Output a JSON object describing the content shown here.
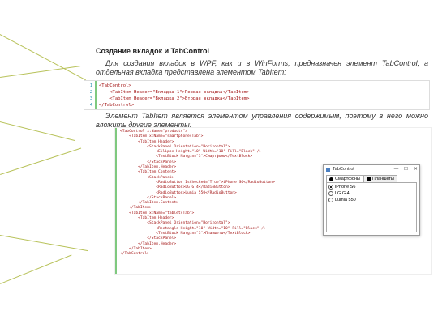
{
  "slide": {
    "title": "Создание вкладок и TabControl",
    "para1": "Для создания вкладок в WPF, как и в WinForms, предназначен элемент TabControl, а отдельная вкладка представлена элементом TabItem:",
    "para2": "Элемент TabItem является элементом управления содержимым, поэтому в него можно вложить другие элементы:"
  },
  "code1": {
    "line_numbers": [
      "1",
      "2",
      "3",
      "4"
    ],
    "lines": [
      "<TabControl>",
      "    <TabItem Header=\"Вкладка 1\">Первая вкладка</TabItem>",
      "    <TabItem Header=\"Вкладка 2\">Вторая вкладка</TabItem>",
      "</TabControl>"
    ]
  },
  "code2": {
    "lines": [
      "<TabControl x:Name=\"products\">",
      "    <TabItem x:Name=\"smartphonesTab\">",
      "        <TabItem.Header>",
      "            <StackPanel Orientation=\"Horizontal\">",
      "                <Ellipse Height=\"10\" Width=\"10\" Fill=\"Black\" />",
      "                <TextBlock Margin=\"3\">Смартфоны</TextBlock>",
      "            </StackPanel>",
      "        </TabItem.Header>",
      "        <TabItem.Content>",
      "            <StackPanel>",
      "                <RadioButton IsChecked=\"True\">iPhone S6</RadioButton>",
      "                <RadioButton>LG G 4</RadioButton>",
      "                <RadioButton>Lumia 550</RadioButton>",
      "            </StackPanel>",
      "        </TabItem.Content>",
      "    </TabItem>",
      "    <TabItem x:Name=\"tabletsTab\">",
      "        <TabItem.Header>",
      "            <StackPanel Orientation=\"Horizontal\">",
      "                <Rectangle Height=\"10\" Width=\"10\" Fill=\"Black\" />",
      "                <TextBlock Margin=\"3\">Планшеты</TextBlock>",
      "            </StackPanel>",
      "        </TabItem.Header>",
      "    </TabItem>",
      "</TabControl>"
    ]
  },
  "window": {
    "title": "TabControl",
    "controls": [
      "—",
      "☐",
      "✕"
    ],
    "tabs": [
      "Смартфоны",
      "Планшеты"
    ],
    "radios": [
      "iPhone S6",
      "LG G 4",
      "Lumia 550"
    ],
    "checked_index": 0
  },
  "colors": {
    "accent": "#b8c25a",
    "code_bar": "#7fc97f"
  }
}
